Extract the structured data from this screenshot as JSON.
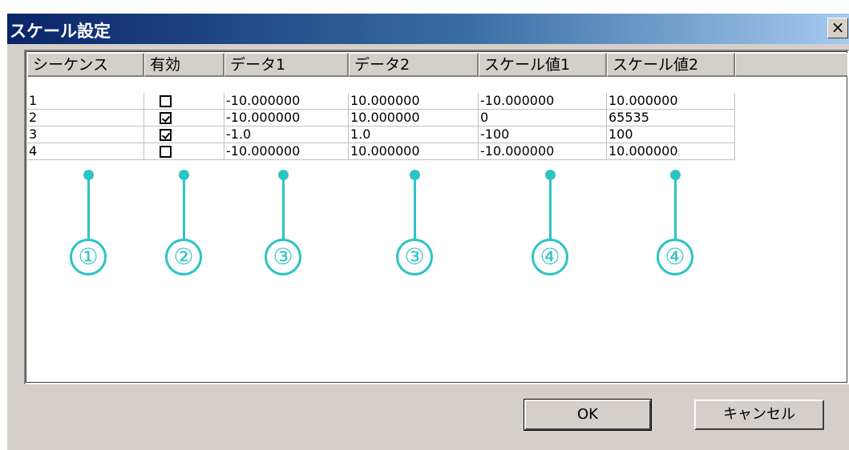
{
  "window": {
    "title": "スケール設定",
    "close_label": "×"
  },
  "table": {
    "headers": [
      "シーケンス",
      "有効",
      "データ1",
      "データ2",
      "スケール値1",
      "スケール値2"
    ],
    "rows": [
      {
        "seq": "1",
        "enabled": false,
        "data1": "-10.000000",
        "data2": "10.000000",
        "scale1": "-10.000000",
        "scale2": "10.000000"
      },
      {
        "seq": "2",
        "enabled": true,
        "data1": "-10.000000",
        "data2": "10.000000",
        "scale1": "0",
        "scale2": "65535"
      },
      {
        "seq": "3",
        "enabled": true,
        "data1": "-1.0",
        "data2": "1.0",
        "scale1": "-100",
        "scale2": "100"
      },
      {
        "seq": "4",
        "enabled": false,
        "data1": "-10.000000",
        "data2": "10.000000",
        "scale1": "-10.000000",
        "scale2": "10.000000"
      }
    ]
  },
  "callouts": [
    "①",
    "②",
    "③",
    "③",
    "④",
    "④"
  ],
  "buttons": {
    "ok": "OK",
    "cancel": "キャンセル"
  },
  "colors": {
    "callout": "#2ec4c4",
    "titlebar_start": "#0a246a",
    "titlebar_end": "#a6caf0",
    "dialog_bg": "#d4d0c8"
  }
}
